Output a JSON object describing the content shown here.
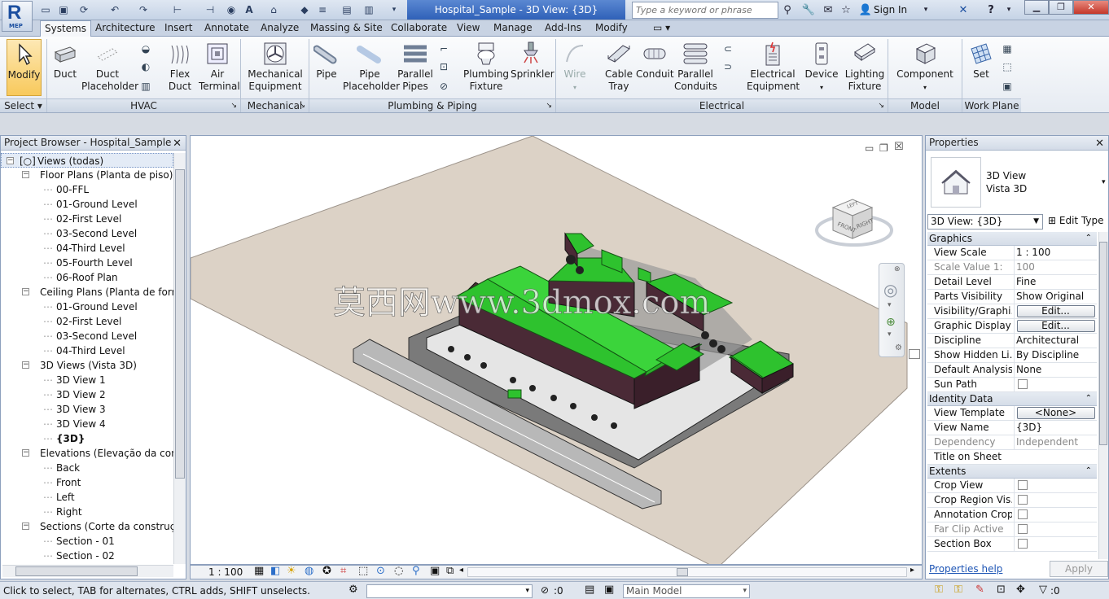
{
  "app": {
    "logo_text": "R",
    "logo_sub": "MEP",
    "window_title": "Hospital_Sample - 3D View: {3D}"
  },
  "search": {
    "placeholder": "Type a keyword or phrase"
  },
  "infocenter": {
    "sign_in": "Sign In"
  },
  "tabs": [
    "Systems",
    "Architecture",
    "Insert",
    "Annotate",
    "Analyze",
    "Massing & Site",
    "Collaborate",
    "View",
    "Manage",
    "Add-Ins",
    "Modify"
  ],
  "active_tab": "Systems",
  "ribbon": {
    "modify": "Modify",
    "select_panel": "Select",
    "hvac": {
      "duct": "Duct",
      "duct_placeholder": [
        "Duct",
        "Placeholder"
      ],
      "flex_duct": [
        "Flex",
        "Duct"
      ],
      "air_terminal": [
        "Air",
        "Terminal"
      ],
      "panel": "HVAC"
    },
    "mechanical": {
      "equipment": [
        "Mechanical",
        "Equipment"
      ],
      "panel": "Mechanical"
    },
    "plumbing": {
      "pipe": "Pipe",
      "pipe_placeholder": [
        "Pipe",
        "Placeholder"
      ],
      "parallel_pipes": [
        "Parallel",
        "Pipes"
      ],
      "fixture": [
        "Plumbing",
        "Fixture"
      ],
      "sprinkler": "Sprinkler",
      "panel": "Plumbing & Piping"
    },
    "electrical": {
      "wire": "Wire",
      "cable_tray": [
        "Cable",
        "Tray"
      ],
      "conduit": "Conduit",
      "parallel_conduits": [
        "Parallel",
        "Conduits"
      ],
      "equipment": [
        "Electrical",
        "Equipment"
      ],
      "device": "Device",
      "lighting": [
        "Lighting",
        "Fixture"
      ],
      "panel": "Electrical"
    },
    "model": {
      "component": "Component",
      "panel": "Model"
    },
    "work_plane": {
      "set": "Set",
      "panel": "Work Plane"
    }
  },
  "browser": {
    "title": "Project Browser - Hospital_Sample",
    "root": "Views (todas)",
    "groups": [
      {
        "label": "Floor Plans (Planta de piso)",
        "items": [
          "00-FFL",
          "01-Ground Level",
          "02-First Level",
          "03-Second Level",
          "04-Third Level",
          "05-Fourth Level",
          "06-Roof Plan"
        ]
      },
      {
        "label": "Ceiling Plans (Planta de forro)",
        "items": [
          "01-Ground Level",
          "02-First Level",
          "03-Second Level",
          "04-Third Level"
        ]
      },
      {
        "label": "3D Views (Vista 3D)",
        "items": [
          "3D View 1",
          "3D View 2",
          "3D View 3",
          "3D View 4",
          "{3D}"
        ]
      },
      {
        "label": "Elevations (Elevação da constru",
        "items": [
          "Back",
          "Front",
          "Left",
          "Right"
        ]
      },
      {
        "label": "Sections (Corte da construção",
        "items": [
          "Section - 01",
          "Section - 02"
        ]
      }
    ]
  },
  "viewport": {
    "scale": "1 : 100",
    "watermark": "莫西网www.3dmox.com",
    "viewcube": {
      "front": "FRONT",
      "right": "RIGHT",
      "left": "LEFT"
    }
  },
  "properties": {
    "title": "Properties",
    "type_name": [
      "3D View",
      "Vista 3D"
    ],
    "instance_selector": "3D View: {3D}",
    "edit_type": "Edit Type",
    "groups": [
      {
        "name": "Graphics",
        "rows": [
          {
            "k": "View Scale",
            "v": "1 : 100"
          },
          {
            "k": "Scale Value    1:",
            "v": "100",
            "dim": true
          },
          {
            "k": "Detail Level",
            "v": "Fine"
          },
          {
            "k": "Parts Visibility",
            "v": "Show Original"
          },
          {
            "k": "Visibility/Graphi...",
            "v": "Edit...",
            "btn": true
          },
          {
            "k": "Graphic Display ...",
            "v": "Edit...",
            "btn": true
          },
          {
            "k": "Discipline",
            "v": "Architectural"
          },
          {
            "k": "Show Hidden Li...",
            "v": "By Discipline"
          },
          {
            "k": "Default Analysis...",
            "v": "None"
          },
          {
            "k": "Sun Path",
            "v": "",
            "chk": true
          }
        ]
      },
      {
        "name": "Identity Data",
        "rows": [
          {
            "k": "View Template",
            "v": "<None>",
            "btn": true
          },
          {
            "k": "View Name",
            "v": "{3D}"
          },
          {
            "k": "Dependency",
            "v": "Independent",
            "dim": true
          },
          {
            "k": "Title on Sheet",
            "v": ""
          }
        ]
      },
      {
        "name": "Extents",
        "rows": [
          {
            "k": "Crop View",
            "v": "",
            "chk": true
          },
          {
            "k": "Crop Region Vis...",
            "v": "",
            "chk": true
          },
          {
            "k": "Annotation Crop",
            "v": "",
            "chk": true
          },
          {
            "k": "Far Clip Active",
            "v": "",
            "chk": true,
            "dim": true
          },
          {
            "k": "Section Box",
            "v": "",
            "chk": true
          }
        ]
      }
    ],
    "help": "Properties help",
    "apply": "Apply"
  },
  "status": {
    "message": "Click to select, TAB for alternates, CTRL adds, SHIFT unselects.",
    "filter_count": ":0",
    "model": "Main Model",
    "right_count": ":0"
  },
  "colors": {
    "roof": "#2ec22e",
    "walls": "#4a2a36",
    "site": "#dcd2c6",
    "ribbon_selected": "#f8c95c",
    "title_active": "#2f61b8"
  }
}
